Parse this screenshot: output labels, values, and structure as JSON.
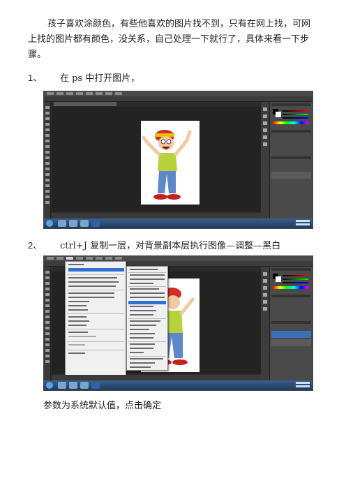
{
  "intro": {
    "text": "孩子喜欢涂颜色，有些他喜欢的图片找不到，只有在网上找，可网上找的图片都有颜色，没关系，自己处理一下就行了，具体来看一下步骤。"
  },
  "steps": [
    {
      "number": "1、",
      "text": "在 ps 中打开图片，"
    },
    {
      "number": "2、",
      "text": "ctrl+J 复制一层，对背景副本层执行图像—调整—黑白"
    }
  ],
  "note": {
    "text": "参数为系统默认值，点击确定"
  },
  "screenshots": [
    {
      "app": "photoshop",
      "icon": "photoshop-window-icon"
    },
    {
      "app": "photoshop",
      "icon": "photoshop-window-icon"
    }
  ],
  "colors": {
    "ps_bg": "#2b2b2b",
    "ps_panel": "#4a4a4a",
    "menu_highlight": "#2f6fd6",
    "taskbar": "#1e3a5f"
  }
}
